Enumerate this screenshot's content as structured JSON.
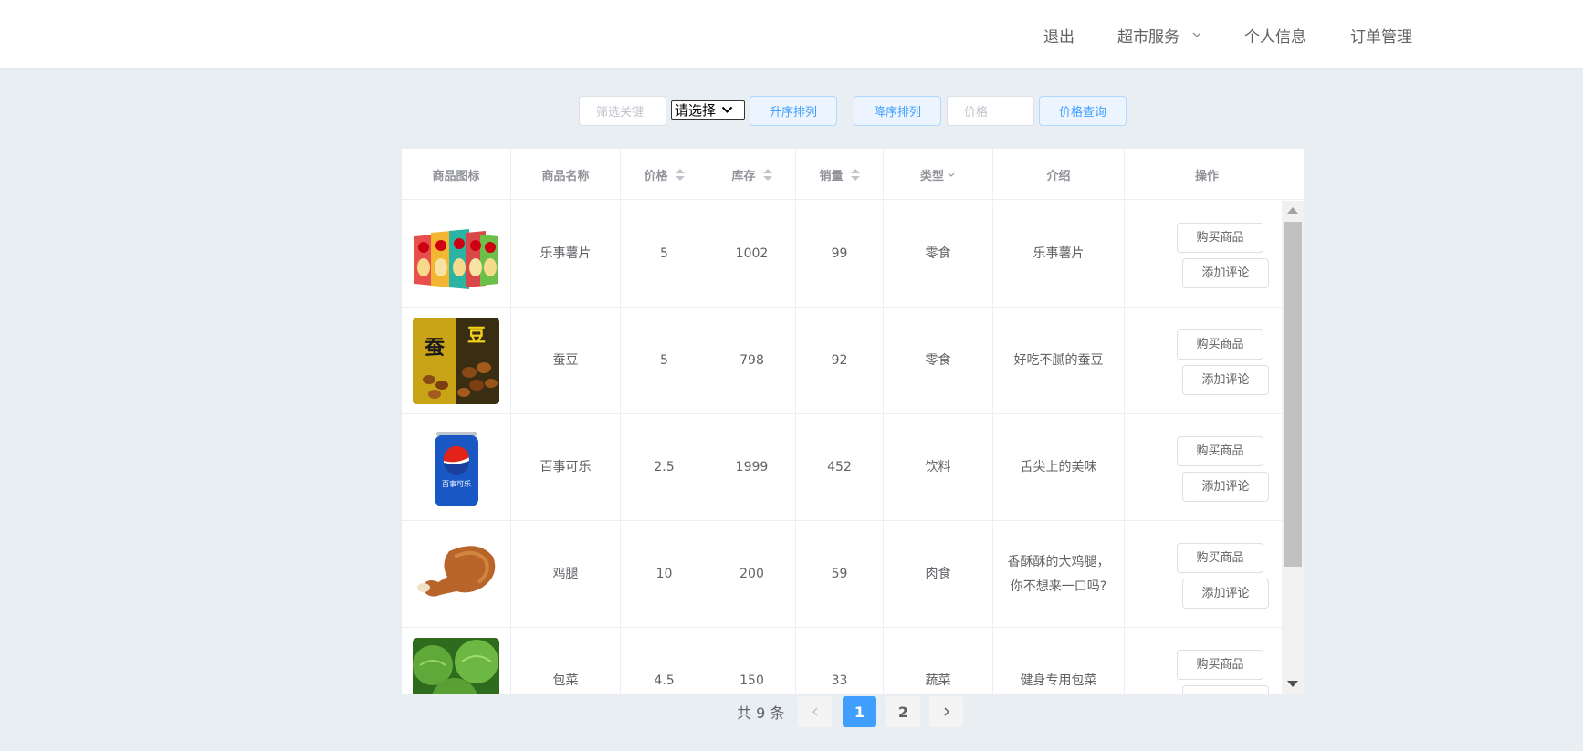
{
  "nav": {
    "logout": "退出",
    "market_service": "超市服务",
    "profile": "个人信息",
    "orders": "订单管理"
  },
  "toolbar": {
    "keyword_placeholder": "筛选关键",
    "select_value": "请选择",
    "asc_label": "升序排列",
    "desc_label": "降序排列",
    "price_placeholder": "价格",
    "price_query_label": "价格查询"
  },
  "table": {
    "headers": [
      "商品图标",
      "商品名称",
      "价格",
      "库存",
      "销量",
      "类型",
      "介绍",
      "操作"
    ],
    "buy_label": "购买商品",
    "comment_label": "添加评论",
    "rows": [
      {
        "name": "乐事薯片",
        "price": "5",
        "stock": "1002",
        "sales": "99",
        "type": "零食",
        "intro": [
          "乐事薯片"
        ],
        "icon": "chips-bag-image"
      },
      {
        "name": "蚕豆",
        "price": "5",
        "stock": "798",
        "sales": "92",
        "type": "零食",
        "intro": [
          "好吃不腻的蚕豆"
        ],
        "icon": "broad-bean-image"
      },
      {
        "name": "百事可乐",
        "price": "2.5",
        "stock": "1999",
        "sales": "452",
        "type": "饮料",
        "intro": [
          "舌尖上的美味"
        ],
        "icon": "cola-can-image"
      },
      {
        "name": "鸡腿",
        "price": "10",
        "stock": "200",
        "sales": "59",
        "type": "肉食",
        "intro": [
          "香酥酥的大鸡腿，",
          "你不想来一口吗?"
        ],
        "icon": "chicken-leg-image"
      },
      {
        "name": "包菜",
        "price": "4.5",
        "stock": "150",
        "sales": "33",
        "type": "蔬菜",
        "intro": [
          "健身专用包菜"
        ],
        "icon": "cabbage-image"
      }
    ]
  },
  "pagination": {
    "total_text": "共 9 条",
    "pages": [
      "1",
      "2"
    ],
    "current": "1"
  },
  "colors": {
    "primary": "#409eff",
    "background": "#e9eef3"
  }
}
